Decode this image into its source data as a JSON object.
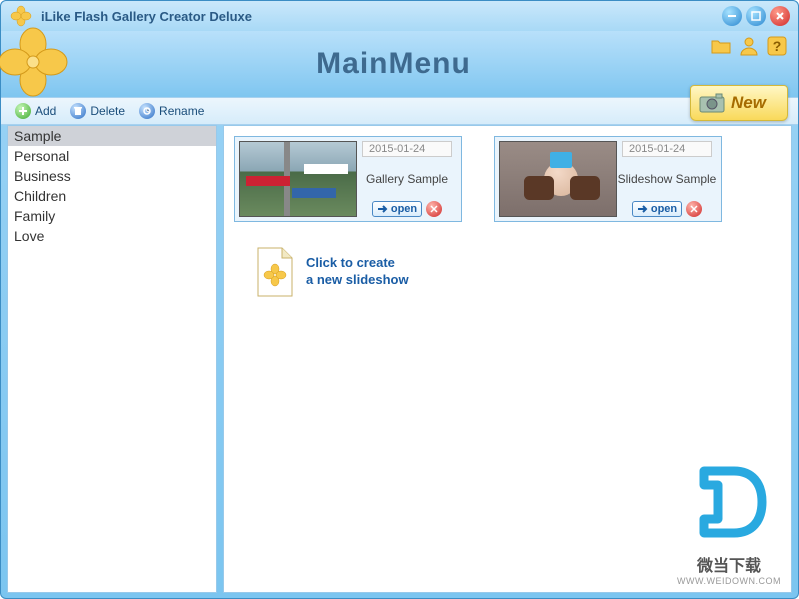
{
  "window": {
    "title": "iLike Flash Gallery Creator Deluxe"
  },
  "header": {
    "title": "MainMenu",
    "new_label": "New"
  },
  "toolbar": {
    "add_label": "Add",
    "delete_label": "Delete",
    "rename_label": "Rename"
  },
  "sidebar": {
    "categories": [
      "Sample",
      "Personal",
      "Business",
      "Children",
      "Family",
      "Love"
    ],
    "selected_index": 0
  },
  "main": {
    "cards": [
      {
        "date": "2015-01-24",
        "name": "Gallery Sample",
        "open_label": "open"
      },
      {
        "date": "2015-01-24",
        "name": "Slideshow Sample",
        "open_label": "open"
      }
    ],
    "create_line1": "Click to create",
    "create_line2": "a new slideshow"
  },
  "watermark": {
    "text1": "微当下载",
    "text2": "WWW.WEIDOWN.COM"
  },
  "colors": {
    "accent": "#1a5da5",
    "gold": "#f7c84a"
  }
}
